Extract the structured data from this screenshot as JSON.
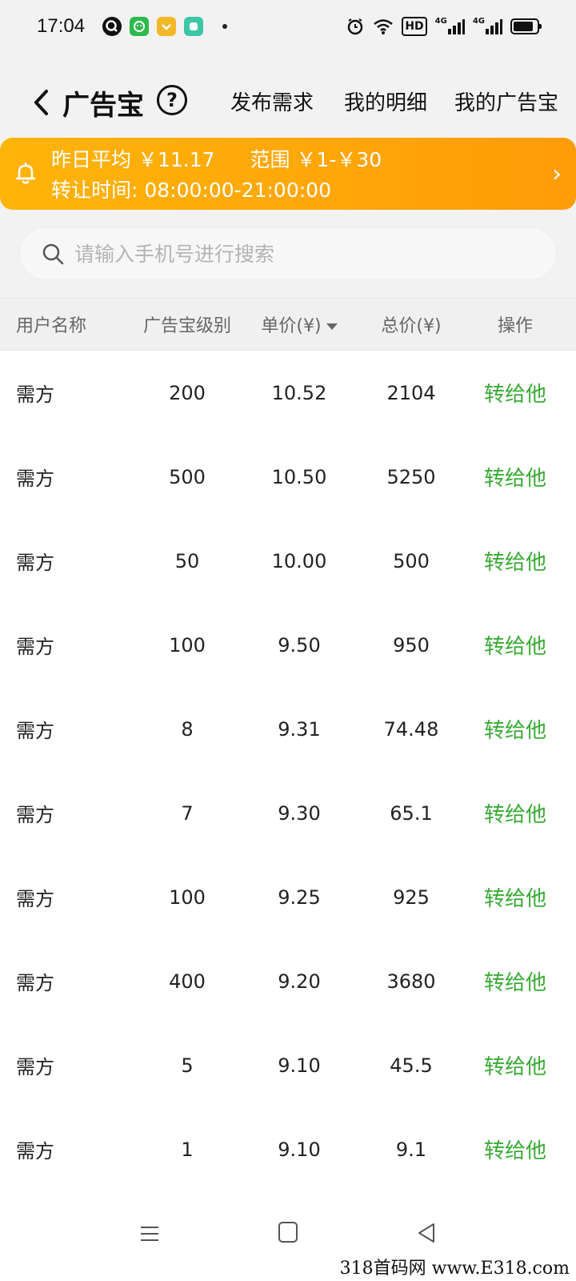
{
  "status_bar": {
    "time": "17:04",
    "app_icons": [
      "q-app-icon",
      "wechat-icon",
      "yellow-app-icon",
      "teal-app-icon"
    ],
    "right_icons": [
      "alarm-icon",
      "wifi-icon",
      "hd-icon",
      "signal-4g-icon",
      "signal-4g-icon",
      "battery-icon"
    ],
    "hd_label": "HD",
    "net_label": "4G"
  },
  "header": {
    "title": "广告宝",
    "help_label": "?",
    "links": [
      "发布需求",
      "我的明细",
      "我的广告宝"
    ]
  },
  "banner": {
    "avg_label": "昨日平均",
    "avg_value": "￥11.17",
    "range_label": "范围",
    "range_value": "￥1-￥30",
    "time_label": "转让时间:",
    "time_value": "08:00:00-21:00:00",
    "chevron": "›"
  },
  "search": {
    "placeholder": "请输入手机号进行搜索"
  },
  "table": {
    "headers": [
      "用户名称",
      "广告宝级别",
      "单价(¥)",
      "总价(¥)",
      "操作"
    ],
    "rows": [
      {
        "user": "需方",
        "level": "200",
        "price": "10.52",
        "total": "2104",
        "action": "转给他"
      },
      {
        "user": "需方",
        "level": "500",
        "price": "10.50",
        "total": "5250",
        "action": "转给他"
      },
      {
        "user": "需方",
        "level": "50",
        "price": "10.00",
        "total": "500",
        "action": "转给他"
      },
      {
        "user": "需方",
        "level": "100",
        "price": "9.50",
        "total": "950",
        "action": "转给他"
      },
      {
        "user": "需方",
        "level": "8",
        "price": "9.31",
        "total": "74.48",
        "action": "转给他"
      },
      {
        "user": "需方",
        "level": "7",
        "price": "9.30",
        "total": "65.1",
        "action": "转给他"
      },
      {
        "user": "需方",
        "level": "100",
        "price": "9.25",
        "total": "925",
        "action": "转给他"
      },
      {
        "user": "需方",
        "level": "400",
        "price": "9.20",
        "total": "3680",
        "action": "转给他"
      },
      {
        "user": "需方",
        "level": "5",
        "price": "9.10",
        "total": "45.5",
        "action": "转给他"
      },
      {
        "user": "需方",
        "level": "1",
        "price": "9.10",
        "total": "9.1",
        "action": "转给他"
      }
    ]
  },
  "colors": {
    "banner_start": "#ffb40a",
    "banner_end": "#ff9c08",
    "action_green": "#3aaa35"
  },
  "watermark": "318首码网 www.E318.com"
}
